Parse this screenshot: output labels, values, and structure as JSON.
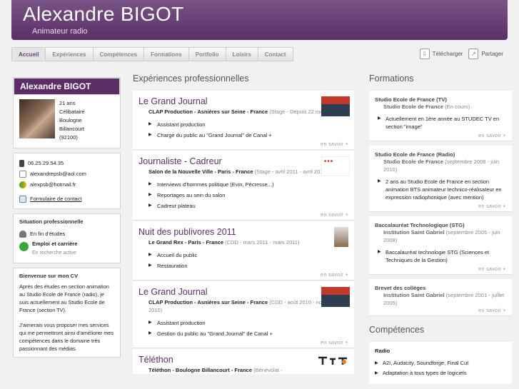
{
  "header": {
    "name": "Alexandre BIGOT",
    "subtitle": "Animateur radio"
  },
  "nav": [
    "Accueil",
    "Expériences",
    "Compétences",
    "Formations",
    "Portfolio",
    "Loisirs",
    "Contact"
  ],
  "tools": {
    "download": "Télécharger",
    "share": "Partager"
  },
  "profile": {
    "name": "Alexandre BIGOT",
    "lines": [
      "21 ans",
      "Célibataire",
      "Boulogne",
      "Billancourt",
      "(92100)"
    ],
    "phone": "06.25.29.54.35",
    "email1": "alexandrepsb@aol.com",
    "email2": "alexpsb@hotmail.fr",
    "contact_form": "Formulaire de contact"
  },
  "situation": {
    "title": "Situation professionnelle",
    "status": "En fin d'études",
    "job_title": "Emploi et carrière",
    "job_status": "En recherche active"
  },
  "welcome": {
    "title": "Bienvenue sur mon CV",
    "p1": "Après des études en section animation au Studio Ecole de France (radio), je suis actuellement au Studio Ecole de France (section TV).",
    "p2": "J'aimerais vous proposer mes services qui me permettront ainsi d'améliorer mes compétences dans le domaine très passionnant des médias."
  },
  "experiences": {
    "title": "Expériences professionnelles",
    "more": "en savoir +",
    "jobs": [
      {
        "title": "Le Grand Journal",
        "company": "CLAP Production - Asnières sur Seine - France",
        "meta": "(Stage - Depuis 22 mois)",
        "items": [
          "Assistant production",
          "Chargé du public au \"Grand Journal\" de Canal +"
        ]
      },
      {
        "title": "Journaliste - Cadreur",
        "company": "Salon de la Nouvelle Ville - Paris - France",
        "meta": "(Stage - avril 2011 - avril 2011)",
        "items": [
          "Interviews d'hommes politique (Evin, Pécresse...)",
          "Reportages au sein du salon",
          "Cadreur plateau"
        ]
      },
      {
        "title": "Nuit des publivores 2011",
        "company": "Le Grand Rex - Paris - France",
        "meta": "(CDD - mars 2011 - mars 2011)",
        "items": [
          "Accueil du public",
          "Restauration"
        ]
      },
      {
        "title": "Le Grand Journal",
        "company": "CLAP Production - Asnières sur Seine - France",
        "meta": "(CDD - août 2010 - novembre 2010)",
        "items": [
          "Assistant production",
          "Gestion du public au \"Grand Journal\" de Canal +"
        ]
      },
      {
        "title": "Téléthon",
        "company": "Téléthon - Boulogne Billancourt - France",
        "meta": "(Bénévolat -",
        "items": []
      }
    ]
  },
  "formations": {
    "title": "Formations",
    "more": "en savoir +",
    "items": [
      {
        "title": "Studio Ecole de France (TV)",
        "inst": "Studio Ecole de France",
        "meta": "(En cours)",
        "bullets": [
          "Actuellement en 1ère année au STUDEC TV en section \"image\""
        ]
      },
      {
        "title": "Studio Ecole de France (Radio)",
        "inst": "Studio Ecole de France",
        "meta": "(septembre 2008 - juin 2010)",
        "bullets": [
          "2 ans au Studio Ecole de France en section animation BTS animateur technico-réalisateur en expression radiophonique (avec mention)"
        ]
      },
      {
        "title": "Baccalauréat Technologique (STG)",
        "inst": "Institution Saint Gabriel",
        "meta": "(septembre 2005 - juin 2008)",
        "bullets": [
          "Baccalauréat technologie STG (Sciences et Techniques de la Gestion)"
        ]
      },
      {
        "title": "Brevet des collèges",
        "inst": "Institution Saint Gabriel",
        "meta": "(septembre 2001 - juillet 2005)",
        "bullets": []
      }
    ]
  },
  "competences": {
    "title": "Compétences",
    "group": "Radio",
    "items": [
      "A2I, Audacity, Soundforge, Final Cut",
      "Adaptation à tous types de logiciels"
    ]
  }
}
